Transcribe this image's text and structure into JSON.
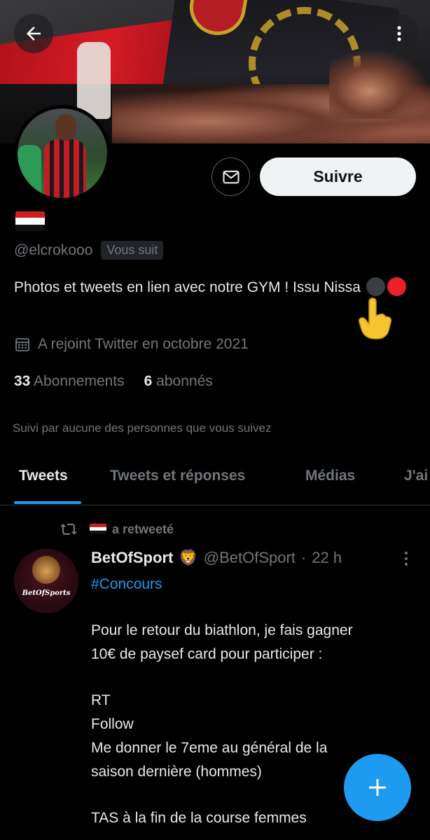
{
  "profile": {
    "handle": "@elcrokooo",
    "follows_you_badge": "Vous suit",
    "bio_text": "Photos et tweets en lien avec notre GYM ! Issu Nissa",
    "joined": "A rejoint Twitter en octobre 2021",
    "following_count": "33",
    "following_label": "Abonnements",
    "followers_count": "6",
    "followers_label": "abonnés",
    "followed_by": "Suivi par aucune des personnes que vous suivez",
    "flag_colors": [
      "#d01c1f",
      "#ffffff",
      "#111111"
    ]
  },
  "actions": {
    "follow_label": "Suivre",
    "message_icon": "envelope-icon",
    "back_icon": "arrow-left-icon",
    "more_icon": "more-vertical-icon"
  },
  "tabs": [
    {
      "label": "Tweets",
      "active": true
    },
    {
      "label": "Tweets et réponses",
      "active": false
    },
    {
      "label": "Médias",
      "active": false
    },
    {
      "label": "J'ai",
      "active": false
    }
  ],
  "tweet": {
    "retweet_label": "a retweeté",
    "author_name": "BetOfSport",
    "author_emoji": "🦁",
    "author_handle": "@BetOfSport",
    "separator": "·",
    "time": "22 h",
    "avatar_text": "BetOfSports",
    "hashtag": "#Concours",
    "lines": [
      "Pour le retour du biathlon, je fais gagner",
      "10€ de paysef card pour participer :",
      "RT",
      "Follow",
      "Me donner le 7eme au général de la",
      "saison dernière (hommes)",
      "TAS à la fin de la course femmes"
    ]
  },
  "colors": {
    "background": "#000000",
    "primary_text": "#e7e9ea",
    "secondary_text": "#71767b",
    "accent": "#1d9bf0",
    "follow_button_bg": "#eff3f4",
    "emblem_red": "#e8222b"
  },
  "fab": {
    "icon": "plus-icon"
  }
}
